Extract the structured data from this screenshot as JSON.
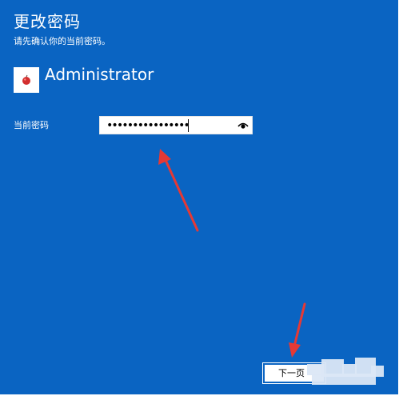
{
  "dialog": {
    "title": "更改密码",
    "subtitle": "请先确认你的当前密码。",
    "user": {
      "avatar_icon": "apple-icon",
      "name": "Administrator"
    },
    "current_password": {
      "label": "当前密码",
      "value": "••••••••••••••••",
      "reveal_icon": "eye-icon"
    },
    "next_button": {
      "label": "下一页"
    }
  },
  "colors": {
    "background": "#0a64c2",
    "annotation_arrow": "#e53935"
  }
}
